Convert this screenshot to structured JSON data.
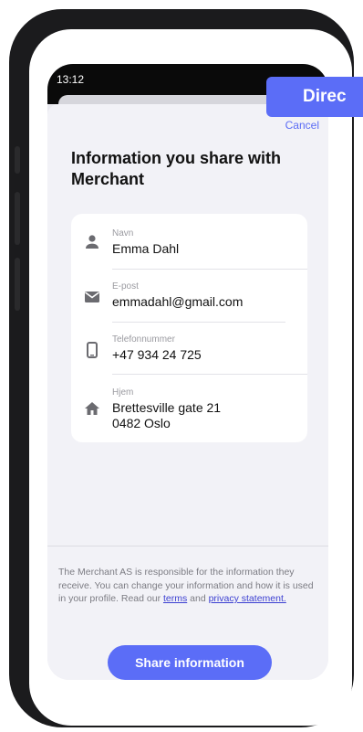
{
  "status_bar": {
    "time": "13:12"
  },
  "banner": {
    "text": "Direc"
  },
  "sheet": {
    "cancel_label": "Cancel",
    "title": "Information you share with Merchant",
    "fields": [
      {
        "label": "Navn",
        "value": "Emma Dahl",
        "icon": "person-icon"
      },
      {
        "label": "E-post",
        "value": "emmadahl@gmail.com",
        "icon": "mail-icon"
      },
      {
        "label": "Telefonnummer",
        "value": "+47 934 24 725",
        "icon": "phone-icon"
      },
      {
        "label": "Hjem",
        "value_line1": "Brettesville gate 21",
        "value_line2": "0482 Oslo",
        "icon": "home-icon"
      }
    ],
    "legal": {
      "text_before": "The Merchant AS is responsible for the information they receive. You can change your information and how it is used in your profile. Read our ",
      "terms_link": "terms",
      "text_middle": " and ",
      "privacy_link": "privacy statement.",
      "text_after": ""
    },
    "share_button_label": "Share information"
  },
  "colors": {
    "accent": "#5b6df7",
    "link": "#3b3fd1",
    "sheet_bg": "#f2f2f7"
  }
}
